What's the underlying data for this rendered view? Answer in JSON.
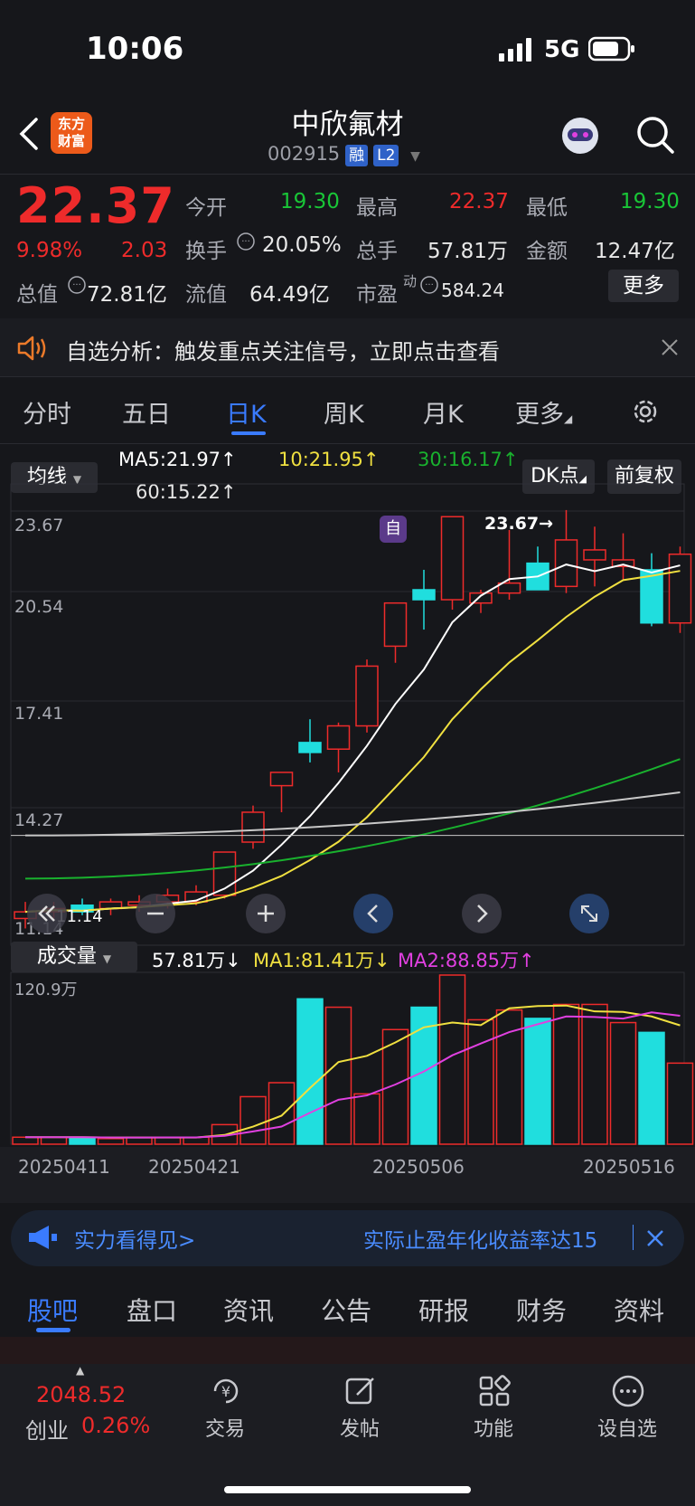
{
  "status": {
    "time": "10:06",
    "network": "5G"
  },
  "header": {
    "logo_line1": "东方",
    "logo_line2": "财富",
    "name": "中欣氟材",
    "code": "002915",
    "tag_rong": "融",
    "tag_l2": "L2"
  },
  "quote": {
    "price": "22.37",
    "change_pct": "9.98%",
    "change": "2.03",
    "open_label": "今开",
    "open": "19.30",
    "high_label": "最高",
    "high": "22.37",
    "low_label": "最低",
    "low": "19.30",
    "turnover_label": "换手",
    "turnover": "20.05%",
    "volume_label": "总手",
    "volume": "57.81万",
    "amount_label": "金额",
    "amount": "12.47亿",
    "mktcap_label": "总值",
    "mktcap": "72.81亿",
    "float_label": "流值",
    "float": "64.49亿",
    "pe_label": "市盈",
    "pe_sup": "动",
    "pe": "584.24",
    "more_button": "更多"
  },
  "notice": {
    "text": "自选分析：触发重点关注信号，立即点击查看"
  },
  "kline_tabs": [
    "分时",
    "五日",
    "日K",
    "周K",
    "月K",
    "更多"
  ],
  "kline_active": "日K",
  "indicators": {
    "ma_button": "均线",
    "ma5": "MA5:21.97↑",
    "ma10": "10:21.95↑",
    "ma30": "30:16.17↑",
    "ma60": "60:15.22↑",
    "dk_button": "DK点",
    "fq_button": "前复权",
    "colors": {
      "ma5": "#ffffff",
      "ma10": "#f0e040",
      "ma30": "#19b12e",
      "ma60": "#c8c8c8",
      "up": "#ee2b2b",
      "down": "#20dede"
    }
  },
  "price_axis": {
    "labels": [
      "23.67",
      "20.54",
      "17.41",
      "14.27",
      "11.14"
    ]
  },
  "annotations": {
    "high_label": "23.67→",
    "low_label": "11.14",
    "self_tag": "自"
  },
  "volume_panel": {
    "button": "成交量",
    "vol": "57.81万↓",
    "ma1": "MA1:81.41万↓",
    "ma2": "MA2:88.85万↑",
    "max_label": "120.9万",
    "colors": {
      "ma1": "#f0e040",
      "ma2": "#e040e0"
    }
  },
  "dates": [
    "20250411",
    "20250421",
    "20250506",
    "20250516"
  ],
  "chart_data": {
    "type": "candlestick",
    "ylim": [
      11.14,
      23.67
    ],
    "candles": [
      {
        "o": 11.4,
        "h": 11.9,
        "l": 11.1,
        "c": 11.6
      },
      {
        "o": 11.6,
        "h": 11.9,
        "l": 11.4,
        "c": 11.7
      },
      {
        "o": 11.8,
        "h": 12.0,
        "l": 11.5,
        "c": 11.6
      },
      {
        "o": 11.7,
        "h": 12.0,
        "l": 11.5,
        "c": 11.9
      },
      {
        "o": 11.8,
        "h": 12.1,
        "l": 11.6,
        "c": 11.9
      },
      {
        "o": 11.9,
        "h": 12.3,
        "l": 11.7,
        "c": 12.1
      },
      {
        "o": 11.9,
        "h": 12.4,
        "l": 11.8,
        "c": 12.2
      },
      {
        "o": 12.1,
        "h": 13.4,
        "l": 12.0,
        "c": 13.4
      },
      {
        "o": 13.7,
        "h": 14.8,
        "l": 13.5,
        "c": 14.6
      },
      {
        "o": 15.4,
        "h": 15.6,
        "l": 14.6,
        "c": 15.8
      },
      {
        "o": 16.7,
        "h": 17.4,
        "l": 16.1,
        "c": 16.4
      },
      {
        "o": 16.5,
        "h": 17.3,
        "l": 15.8,
        "c": 17.2
      },
      {
        "o": 17.2,
        "h": 19.2,
        "l": 17.0,
        "c": 19.0
      },
      {
        "o": 19.6,
        "h": 20.9,
        "l": 19.1,
        "c": 20.9
      },
      {
        "o": 21.3,
        "h": 21.9,
        "l": 20.1,
        "c": 21.0
      },
      {
        "o": 21.0,
        "h": 23.5,
        "l": 20.7,
        "c": 23.5
      },
      {
        "o": 20.9,
        "h": 21.3,
        "l": 20.6,
        "c": 21.2
      },
      {
        "o": 21.2,
        "h": 23.1,
        "l": 21.0,
        "c": 21.5
      },
      {
        "o": 22.1,
        "h": 22.6,
        "l": 21.6,
        "c": 21.3
      },
      {
        "o": 21.4,
        "h": 23.7,
        "l": 21.2,
        "c": 22.8
      },
      {
        "o": 22.2,
        "h": 23.2,
        "l": 21.4,
        "c": 22.5
      },
      {
        "o": 22.0,
        "h": 23.0,
        "l": 21.6,
        "c": 22.2
      },
      {
        "o": 21.9,
        "h": 22.4,
        "l": 20.2,
        "c": 20.3
      },
      {
        "o": 20.3,
        "h": 22.6,
        "l": 20.0,
        "c": 22.37
      }
    ],
    "volumes": [
      5,
      5,
      5,
      4,
      5,
      5,
      5,
      14,
      34,
      44,
      104,
      98,
      36,
      82,
      98,
      121,
      89,
      96,
      90,
      100,
      100,
      87,
      80,
      58
    ],
    "vol_max": 121
  },
  "banner": {
    "left": "实力看得见>",
    "right": "实际止盈年化收益率达15"
  },
  "bottom_tabs": [
    "股吧",
    "盘口",
    "资讯",
    "公告",
    "研报",
    "财务",
    "资料"
  ],
  "bottom_active": "股吧",
  "nav": {
    "index_value": "2048.52",
    "index_name": "创业",
    "index_change": "0.26%",
    "trade": "交易",
    "post": "发帖",
    "func": "功能",
    "watch": "设自选"
  }
}
